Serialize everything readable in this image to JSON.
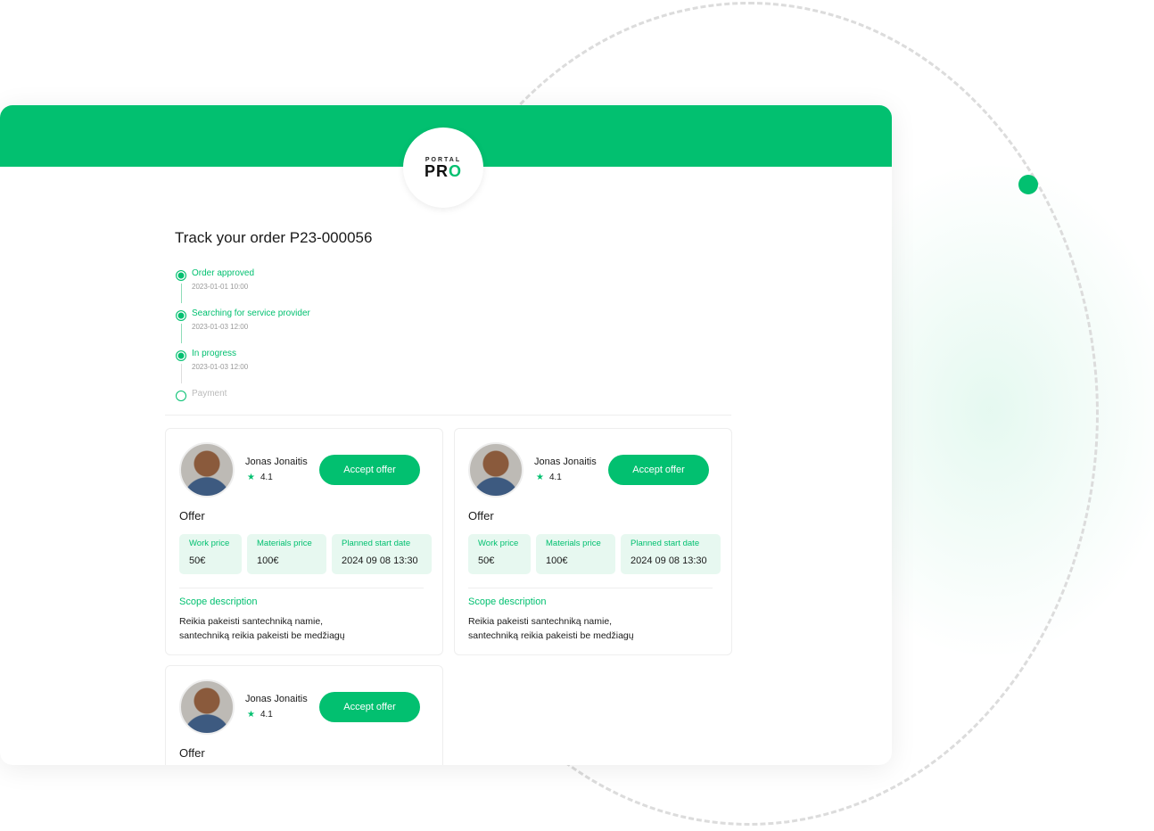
{
  "logo": {
    "small": "PORTAL",
    "big": "PR",
    "big_o": "O"
  },
  "title": "Track your order P23-000056",
  "timeline": [
    {
      "label": "Order approved",
      "date": "2023-01-01 10:00",
      "done": true
    },
    {
      "label": "Searching for service provider",
      "date": "2023-01-03 12:00",
      "done": true
    },
    {
      "label": "In progress",
      "date": "2023-01-03 12:00",
      "done": true
    },
    {
      "label": "Payment",
      "date": "",
      "done": false
    }
  ],
  "offers": [
    {
      "name": "Jonas Jonaitis",
      "rating": "4.1",
      "accept": "Accept offer",
      "offer": "Offer",
      "work_label": "Work price",
      "work": "50€",
      "mat_label": "Materials price",
      "mat": "100€",
      "date_label": "Planned start date",
      "date": "2024 09 08 13:30",
      "scope_label": "Scope description",
      "scope1": "Reikia pakeisti santechniką namie,",
      "scope2": "santechniką reikia pakeisti be medžiagų"
    },
    {
      "name": "Jonas Jonaitis",
      "rating": "4.1",
      "accept": "Accept offer",
      "offer": "Offer",
      "work_label": "Work price",
      "work": "50€",
      "mat_label": "Materials price",
      "mat": "100€",
      "date_label": "Planned start date",
      "date": "2024 09 08 13:30",
      "scope_label": "Scope description",
      "scope1": "Reikia pakeisti santechniką namie,",
      "scope2": "santechniką reikia pakeisti be medžiagų"
    },
    {
      "name": "Jonas Jonaitis",
      "rating": "4.1",
      "accept": "Accept offer",
      "offer": "Offer"
    }
  ],
  "colors": {
    "accent": "#02c070",
    "box": "#e7f8f0"
  },
  "icons": {
    "rating": "star-icon"
  }
}
